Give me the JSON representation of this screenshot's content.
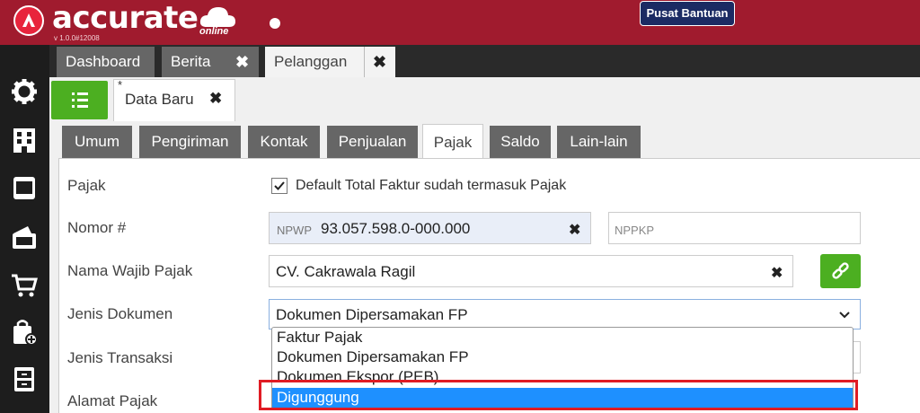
{
  "app": {
    "name": "accurate",
    "tagline": "online",
    "version": "v 1.0.0#12008",
    "help_label": "Pusat Bantuan"
  },
  "colors": {
    "topbar": "#a01b2e",
    "accent_green": "#4caf21",
    "selection_blue": "#1e90ff",
    "highlight_red": "#e01c24"
  },
  "sidebar": {
    "icons": [
      "gear-icon",
      "building-icon",
      "book-icon",
      "wallet-icon",
      "cart-icon",
      "shopping-bag-add-icon",
      "archive-icon"
    ]
  },
  "main_tabs": [
    {
      "label": "Dashboard",
      "closable": false,
      "active": false
    },
    {
      "label": "Berita",
      "closable": true,
      "active": false
    },
    {
      "label": "Pelanggan",
      "closable": true,
      "active": true
    }
  ],
  "doc_tab": {
    "label": "Data Baru",
    "modified_marker": "*"
  },
  "sub_tabs": [
    {
      "label": "Umum",
      "active": false
    },
    {
      "label": "Pengiriman",
      "active": false
    },
    {
      "label": "Kontak",
      "active": false
    },
    {
      "label": "Penjualan",
      "active": false
    },
    {
      "label": "Pajak",
      "active": true
    },
    {
      "label": "Saldo",
      "active": false
    },
    {
      "label": "Lain-lain",
      "active": false
    }
  ],
  "form": {
    "pajak_label": "Pajak",
    "default_total_checkbox": {
      "label": "Default Total Faktur sudah termasuk Pajak",
      "checked": true
    },
    "nomor_label": "Nomor #",
    "npwp_prefix": "NPWP",
    "npwp_value": "93.057.598.0-000.000",
    "nppkp_placeholder": "NPPKP",
    "nama_label": "Nama Wajib Pajak",
    "nama_value": "CV. Cakrawala Ragil",
    "jenis_dokumen_label": "Jenis Dokumen",
    "jenis_dokumen_value": "Dokumen Dipersamakan FP",
    "jenis_transaksi_label": "Jenis Transaksi",
    "alamat_label": "Alamat Pajak"
  },
  "dropdown": {
    "options": [
      "Faktur Pajak",
      "Dokumen Dipersamakan FP",
      "Dokumen Ekspor (PEB)",
      "Digunggung"
    ],
    "highlighted": "Digunggung"
  }
}
